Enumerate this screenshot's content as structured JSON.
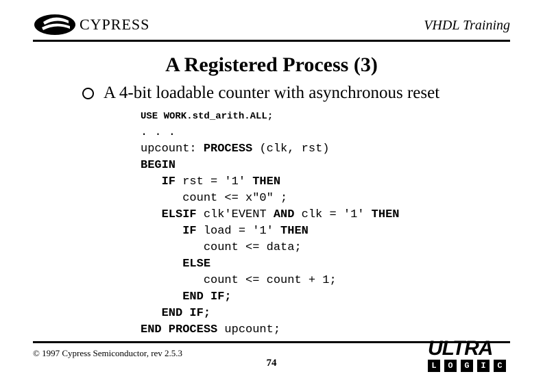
{
  "header": {
    "brand": "CYPRESS",
    "right_label": "VHDL Training"
  },
  "title": "A Registered Process (3)",
  "bullet": "A 4-bit loadable counter with asynchronous reset",
  "code": {
    "use_line": "USE WORK.std_arith.ALL;",
    "ellipsis": ". . .",
    "l_upcount_pre": "upcount: ",
    "kw_process": "PROCESS",
    "l_upcount_post": " (clk, rst)",
    "kw_begin": "BEGIN",
    "kw_if1": "IF",
    "l_rst": " rst = '1' ",
    "kw_then": "THEN",
    "l_cnt0": "count <= x\"0\" ;",
    "kw_elsif": "ELSIF",
    "l_clk_a": " clk'EVENT ",
    "kw_and": "AND",
    "l_clk_b": " clk = '1' ",
    "kw_if2": "IF",
    "l_load": " load = '1' ",
    "l_cnt_data": "count <= data;",
    "kw_else": "ELSE",
    "l_cnt_inc": "count <= count + 1;",
    "kw_endif": "END IF;",
    "kw_endproc": "END PROCESS",
    "l_endproc_post": " upcount;"
  },
  "footer": {
    "copyright": "© 1997 Cypress Semiconductor, rev 2.5.3",
    "page": "74",
    "brand_top": "ULTRA",
    "logic_letters": [
      "L",
      "O",
      "G",
      "I",
      "C"
    ]
  }
}
